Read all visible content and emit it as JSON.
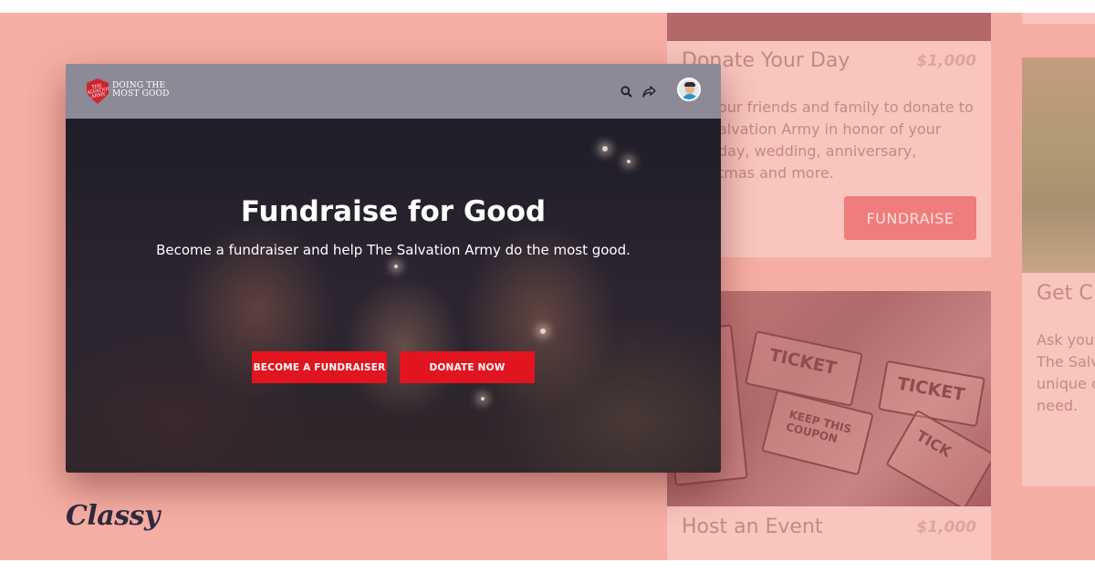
{
  "cards": {
    "donate_day": {
      "title": "Donate Your Day",
      "amount": "$1,000",
      "desc_lines": [
        "our friends and family to donate to",
        "alvation Army in honor of your",
        "day, wedding, anniversary,",
        "tmas and more."
      ],
      "button": "FUNDRAISE"
    },
    "host_event": {
      "title": "Host an Event",
      "amount": "$1,000",
      "ticket_words": [
        "TICKET",
        "KEEP THIS COUPON",
        "TICKET",
        "TICK"
      ]
    },
    "right_card": {
      "title": "Get C",
      "desc_lines": [
        "Ask your",
        "The Salv",
        "unique c",
        "need."
      ]
    }
  },
  "browser": {
    "logo": {
      "line1": "DOING THE",
      "line2": "MOST GOOD",
      "shield_text": "THE SALVATION ARMY"
    },
    "icons": {
      "search": "search-icon",
      "share": "share-icon",
      "avatar": "user-avatar"
    },
    "hero": {
      "title": "Fundraise for Good",
      "subtitle": "Become a fundraiser and help The Salvation Army do the most good.",
      "primary_button": "BECOME A FUNDRAISER",
      "secondary_button": "DONATE NOW"
    }
  },
  "brand": {
    "name": "Classy"
  },
  "colors": {
    "background": "#f6aea4",
    "accent": "#e1151f",
    "topbar": "#8b8a96",
    "brand_text": "#2e2a3c"
  }
}
